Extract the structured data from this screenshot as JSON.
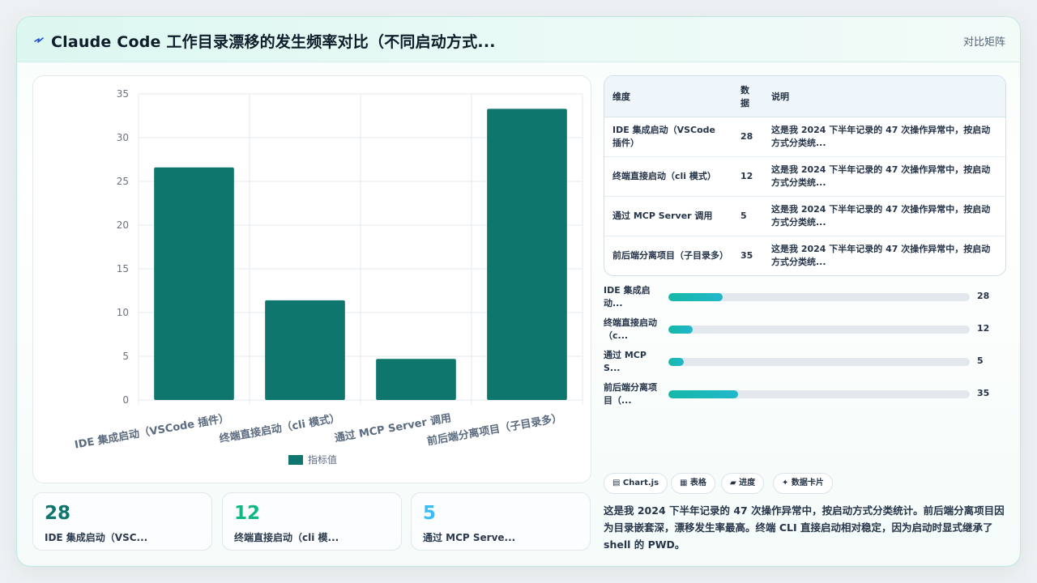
{
  "header": {
    "icon": "lightning-icon",
    "title": "Claude Code 工作目录漂移的发生频率对比（不同启动方式...",
    "right_label": "对比矩阵"
  },
  "chart_data": {
    "type": "bar",
    "categories": [
      "IDE 集成启动（VSCode 插件）",
      "终端直接启动（cli 模式）",
      "通过 MCP Server 调用",
      "前后端分离项目（子目录多）"
    ],
    "series": [
      {
        "name": "指标值",
        "values": [
          26.6,
          11.4,
          4.7,
          33.3
        ],
        "color": "#0f766e"
      }
    ],
    "ylim": [
      0,
      35
    ],
    "yticks": [
      0,
      5,
      10,
      15,
      20,
      25,
      30,
      35
    ],
    "grid": true,
    "legend": "bottom",
    "xlabel": "",
    "ylabel": ""
  },
  "stats": [
    {
      "value": "28",
      "label": "IDE 集成启动（VSC...",
      "color": "#0f766e"
    },
    {
      "value": "12",
      "label": "终端直接启动（cli 模...",
      "color": "#10b981"
    },
    {
      "value": "5",
      "label": "通过 MCP Serve...",
      "color": "#38bdf8"
    }
  ],
  "table": {
    "headers": [
      "维度",
      "数据",
      "说明"
    ],
    "rows": [
      {
        "dim": "IDE 集成启动（VSCode 插件）",
        "num": "28",
        "desc": "这是我 2024 下半年记录的 47 次操作异常中，按启动方式分类统..."
      },
      {
        "dim": "终端直接启动（cli 模式）",
        "num": "12",
        "desc": "这是我 2024 下半年记录的 47 次操作异常中，按启动方式分类统..."
      },
      {
        "dim": "通过 MCP Server 调用",
        "num": "5",
        "desc": "这是我 2024 下半年记录的 47 次操作异常中，按启动方式分类统..."
      },
      {
        "dim": "前后端分离项目（子目录多）",
        "num": "35",
        "desc": "这是我 2024 下半年记录的 47 次操作异常中，按启动方式分类统..."
      }
    ]
  },
  "progress": [
    {
      "label": "IDE 集成启动...",
      "value": "28",
      "fraction": 0.18
    },
    {
      "label": "终端直接启动（c...",
      "value": "12",
      "fraction": 0.08
    },
    {
      "label": "通过 MCP S...",
      "value": "5",
      "fraction": 0.05
    },
    {
      "label": "前后端分离项目（...",
      "value": "35",
      "fraction": 0.23
    }
  ],
  "chips": [
    "▤ Chart.js",
    "▦ 表格",
    "▰ 进度",
    "✦ 数据卡片"
  ],
  "note": "这是我 2024 下半年记录的 47 次操作异常中，按启动方式分类统计。前后端分离项目因为目录嵌套深，漂移发生率最高。终端 CLI 直接启动相对稳定，因为启动时显式继承了 shell 的 PWD。"
}
